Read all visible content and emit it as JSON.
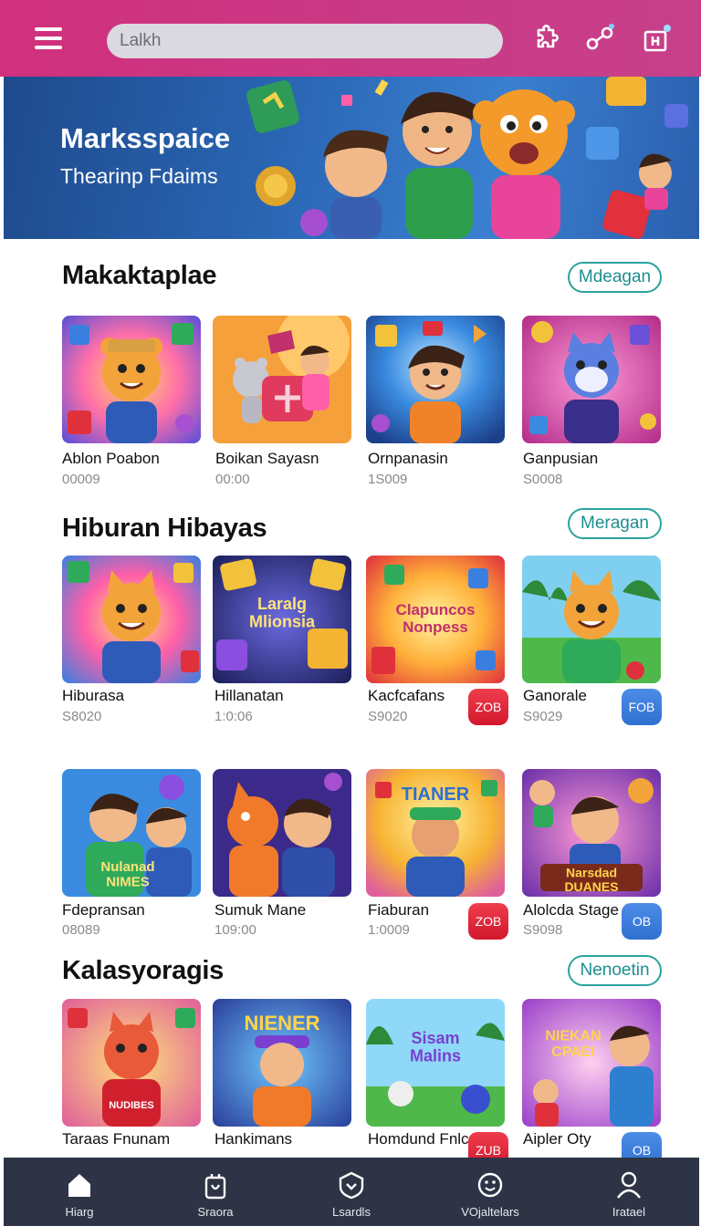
{
  "header": {
    "search_placeholder": "Lalkh",
    "icons": [
      "menu-icon",
      "puzzle-icon",
      "link-icon",
      "gift-icon"
    ]
  },
  "banner": {
    "title": "Marksspaice",
    "subtitle": "Thearinp Fdaims"
  },
  "sections": [
    {
      "title": "Makaktaplae",
      "more_label": "Mdeagan",
      "cards": [
        {
          "title": "Ablon Poabon",
          "sub": "00009"
        },
        {
          "title": "Boikan Sayasn",
          "sub": "00:00"
        },
        {
          "title": "Ornpanasin",
          "sub": "1S009"
        },
        {
          "title": "Ganpusian",
          "sub": "S0008"
        }
      ]
    },
    {
      "title": "Hiburan Hibayas",
      "more_label": "Meragan",
      "cards": [
        {
          "title": "Hiburasa",
          "sub": "S8020",
          "art_text": ""
        },
        {
          "title": "Hillanatan",
          "sub": "1:0:06",
          "art_text": "Laralg Mlionsia"
        },
        {
          "title": "Kacfcafans",
          "sub": "S9020",
          "badge": "ZOB",
          "art_text": "Clapuncos Nonpess"
        },
        {
          "title": "Ganorale",
          "sub": "S9029",
          "badge": "FOB"
        }
      ]
    },
    {
      "title": "",
      "more_label": "",
      "cards": [
        {
          "title": "Fdepransan",
          "sub": "08089",
          "art_text": "Nulanad NIMES"
        },
        {
          "title": "Sumuk Mane",
          "sub": "109:00"
        },
        {
          "title": "Fiaburan",
          "sub": "1:0009",
          "badge": "ZOB",
          "art_text": "TIANER"
        },
        {
          "title": "Alolcda Stage",
          "sub": "S9098",
          "badge": "OB",
          "art_text": "Narsdad DUANES"
        }
      ]
    },
    {
      "title": "Kalasyoragis",
      "more_label": "Nenoetin",
      "cards": [
        {
          "title": "Taraas Fnunam",
          "sub": "",
          "art_text": "NUDIBES"
        },
        {
          "title": "Hankimans",
          "sub": "",
          "art_text": "NIENER"
        },
        {
          "title": "Homdund Fnlc",
          "sub": "",
          "badge": "ZUB",
          "art_text": "Sisam Malins"
        },
        {
          "title": "Aipler Oty",
          "sub": "",
          "badge": "OB",
          "art_text": "NIEKAN CPAEI"
        }
      ]
    }
  ],
  "nav": [
    {
      "label": "Hiarg",
      "icon": "home-icon"
    },
    {
      "label": "Sraora",
      "icon": "store-icon"
    },
    {
      "label": "Lsardls",
      "icon": "shield-icon"
    },
    {
      "label": "VOjaltelars",
      "icon": "smile-icon"
    },
    {
      "label": "Iratael",
      "icon": "profile-icon"
    }
  ],
  "colors": {
    "header": "#d0307c",
    "accent_teal": "#2aa3a0",
    "badge_red": "#e12a3c",
    "badge_blue": "#3c7ddc",
    "nav_bg": "#2e3445"
  }
}
